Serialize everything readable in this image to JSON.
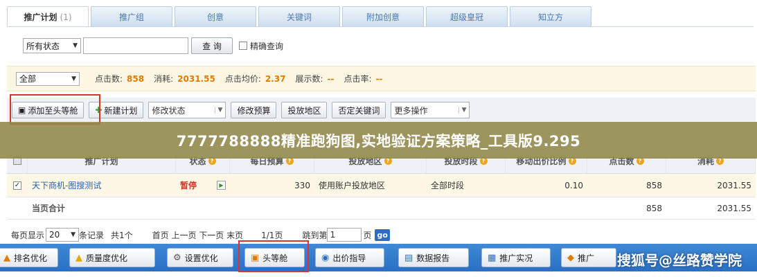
{
  "tabs": [
    {
      "label": "推广计划",
      "count": "(1)",
      "active": true
    },
    {
      "label": "推广组"
    },
    {
      "label": "创意"
    },
    {
      "label": "关键词"
    },
    {
      "label": "附加创意"
    },
    {
      "label": "超级皇冠"
    },
    {
      "label": "知立方"
    }
  ],
  "filter": {
    "status_select": "所有状态",
    "search_value": "",
    "query_button": "查 询",
    "exact_label": "精确查询"
  },
  "stats": {
    "range_select": "全部",
    "clicks_label": "点击数:",
    "clicks_value": "858",
    "cost_label": "消耗:",
    "cost_value": "2031.55",
    "avg_price_label": "点击均价:",
    "avg_price_value": "2.37",
    "impressions_label": "展示数:",
    "impressions_value": "--",
    "ctr_label": "点击率:",
    "ctr_value": "--"
  },
  "toolbar": {
    "add_top_label": "添加至头等舱",
    "new_plan_label": "新建计划",
    "modify_status_label": "修改状态",
    "modify_budget_label": "修改预算",
    "region_label": "投放地区",
    "negative_kw_label": "否定关键词",
    "more_ops_label": "更多操作"
  },
  "banner": {
    "text": "7777788888精准跑狗图,实地验证方案策略_工具版9.295"
  },
  "table": {
    "columns": [
      "推广计划",
      "状态",
      "每日预算",
      "投放地区",
      "投放时段",
      "移动出价比例",
      "点击数",
      "消耗"
    ],
    "rows": [
      {
        "name": "天下商机-图搜测试",
        "status": "暂停",
        "budget": "330",
        "region": "使用账户投放地区",
        "schedule": "全部时段",
        "mobile_ratio": "0.10",
        "clicks": "858",
        "cost": "2031.55"
      }
    ],
    "total": {
      "label": "当页合计",
      "clicks": "858",
      "cost": "2031.55"
    }
  },
  "pager": {
    "per_page_label": "每页显示",
    "per_page_value": "20",
    "records_label": "条记录",
    "total_label": "共1个",
    "nav": "首页 上一页 下一页 末页",
    "page_info": "1/1页",
    "jump_label": "跳到第",
    "jump_value": "1",
    "page_suffix": "页",
    "go_label": "go"
  },
  "bottom_bar": {
    "items": [
      "排名优化",
      "质量度优化",
      "设置优化",
      "头等舱",
      "出价指导",
      "数据报告",
      "推广实况",
      "推广"
    ],
    "watermark": "搜狐号@丝路赞学院"
  },
  "colors": {
    "accent_orange": "#e07b00",
    "status_red": "#d9342b",
    "link_blue": "#2660b3",
    "bottom_bar_blue": "#2a6fc3",
    "highlight_red_box": "#d9342b"
  }
}
